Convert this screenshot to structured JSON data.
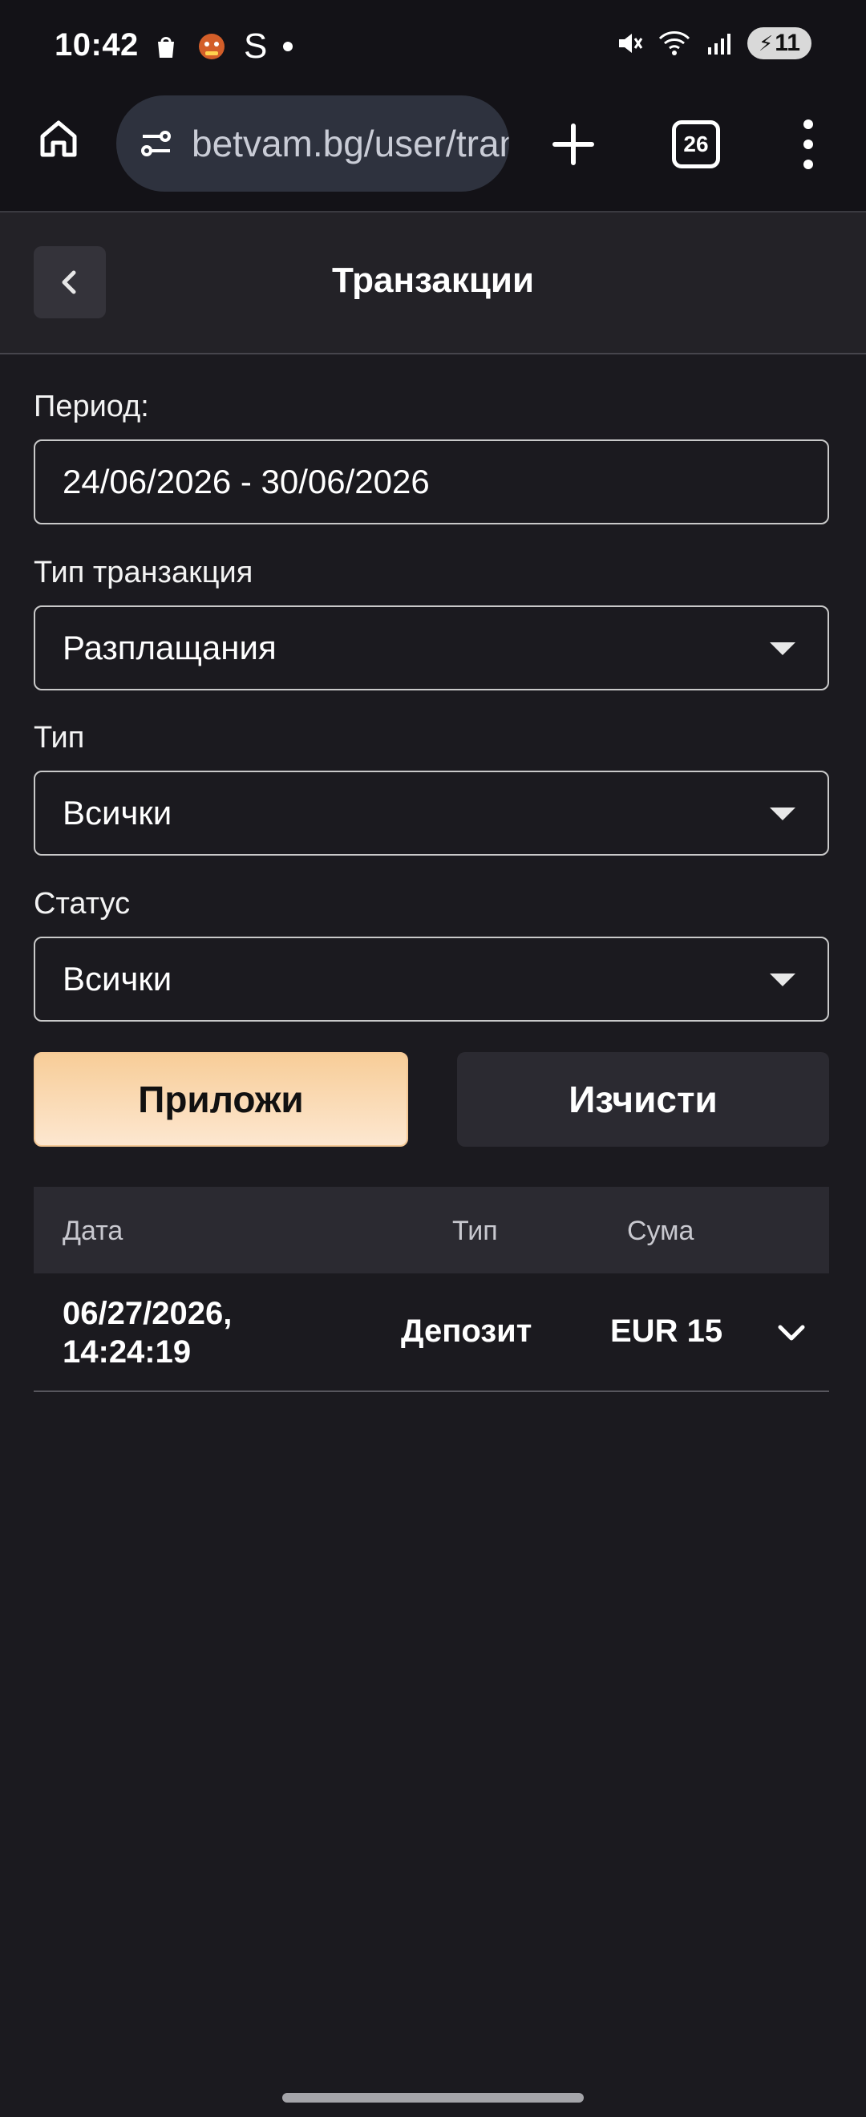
{
  "status_bar": {
    "time": "10:42",
    "notif_s": "S",
    "battery": "11"
  },
  "browser": {
    "url": "betvam.bg/user/transactions",
    "tab_count": "26"
  },
  "page": {
    "title": "Транзакции"
  },
  "filters": {
    "period_label": "Период:",
    "period_value": "24/06/2026 - 30/06/2026",
    "transaction_type_label": "Тип транзакция",
    "transaction_type_value": "Разплащания",
    "type_label": "Тип",
    "type_value": "Всички",
    "status_label": "Статус",
    "status_value": "Всички"
  },
  "buttons": {
    "apply": "Приложи",
    "clear": "Изчисти"
  },
  "table": {
    "headers": {
      "date": "Дата",
      "type": "Тип",
      "amount": "Сума"
    },
    "rows": [
      {
        "date_line1": "06/27/2026,",
        "date_line2": "14:24:19",
        "type": "Депозит",
        "amount": "EUR 15"
      }
    ]
  },
  "icons": {
    "home": "home-icon",
    "site_settings": "site-settings-icon",
    "new_tab": "plus-icon",
    "tabs": "tabs-icon",
    "menu": "more-vert-icon",
    "back": "chevron-left-icon",
    "expand": "chevron-down-icon"
  }
}
